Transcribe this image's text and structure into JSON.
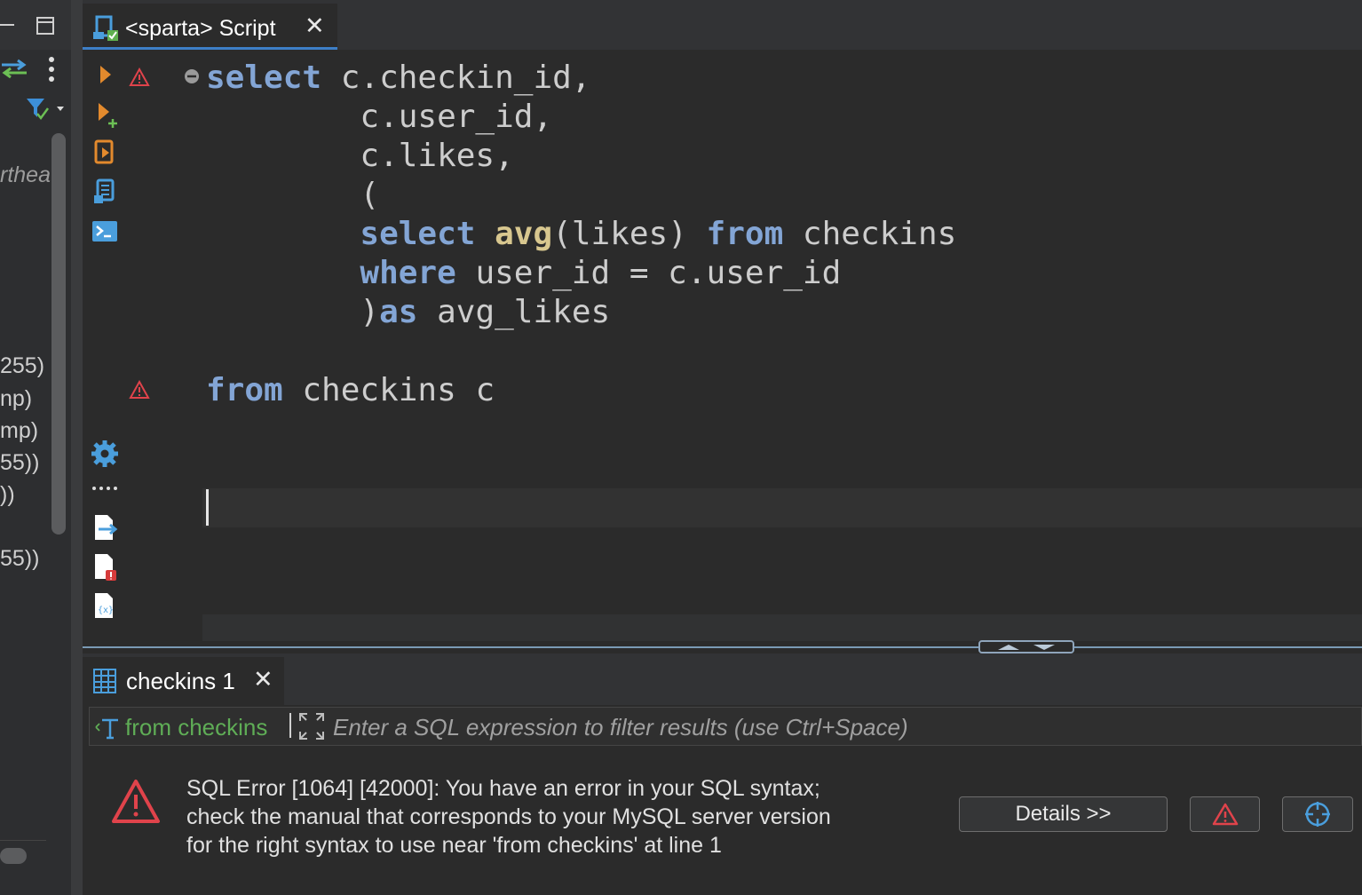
{
  "left_panel": {
    "tree_fragments": [
      "rthea",
      "255)",
      "np)",
      "mp)",
      "55))",
      "))",
      "55))"
    ]
  },
  "editor": {
    "tab_title": "<sparta> Script",
    "tab_close": "✕",
    "code_lines": [
      [
        {
          "t": "select",
          "c": "kw"
        },
        {
          "t": " c.checkin_id,",
          "c": ""
        }
      ],
      [
        {
          "t": "        c.user_id,",
          "c": ""
        }
      ],
      [
        {
          "t": "        c.likes,",
          "c": ""
        }
      ],
      [
        {
          "t": "        (",
          "c": ""
        }
      ],
      [
        {
          "t": "        ",
          "c": ""
        },
        {
          "t": "select",
          "c": "kw"
        },
        {
          "t": " ",
          "c": ""
        },
        {
          "t": "avg",
          "c": "fn"
        },
        {
          "t": "(likes) ",
          "c": ""
        },
        {
          "t": "from",
          "c": "kw"
        },
        {
          "t": " checkins",
          "c": ""
        }
      ],
      [
        {
          "t": "        ",
          "c": ""
        },
        {
          "t": "where",
          "c": "kw"
        },
        {
          "t": " user_id = c.user_id",
          "c": ""
        }
      ],
      [
        {
          "t": "        )",
          "c": ""
        },
        {
          "t": "as",
          "c": "kw"
        },
        {
          "t": " avg_likes",
          "c": ""
        }
      ],
      [],
      [
        {
          "t": "from",
          "c": "kw"
        },
        {
          "t": " checkins c",
          "c": ""
        }
      ]
    ],
    "toolbar_icons": [
      "execute-statement-icon",
      "execute-new-tab-icon",
      "execute-script-icon",
      "explain-plan-icon",
      "open-console-icon",
      "settings-gear-icon",
      "more-dots-icon",
      "export-icon",
      "file-error-icon",
      "variables-icon"
    ]
  },
  "results": {
    "tab_title": "checkins 1",
    "tab_close": "✕",
    "filter_query": "from checkins",
    "filter_placeholder": "Enter a SQL expression to filter results (use Ctrl+Space)",
    "error_lines": [
      "SQL Error [1064] [42000]: You have an error in your SQL syntax;",
      "check the manual that corresponds to your MySQL server version",
      "for the right syntax to use near 'from checkins' at line 1"
    ],
    "details_button": "Details >>"
  },
  "colors": {
    "keyword": "#83a5d5",
    "function": "#d8c78f",
    "error_red": "#e0434b",
    "accent_blue": "#3d7fc7",
    "filter_green": "#5fad56"
  }
}
